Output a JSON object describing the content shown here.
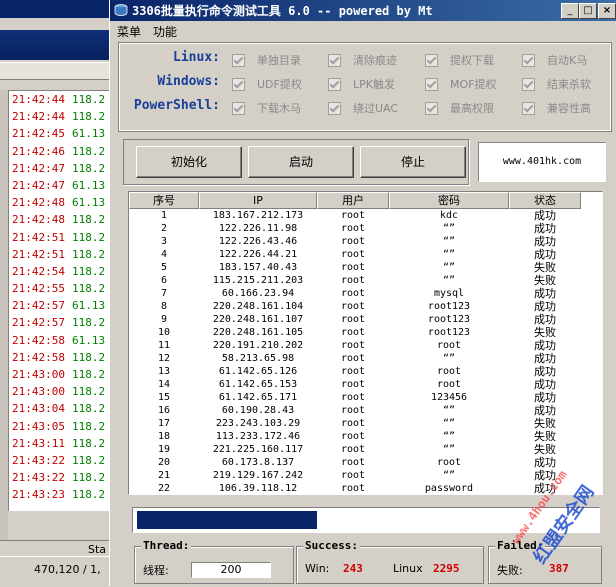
{
  "background_window": {
    "log_rows": [
      {
        "time": "21:42:44",
        "ip": "118.2"
      },
      {
        "time": "21:42:44",
        "ip": "118.2"
      },
      {
        "time": "21:42:45",
        "ip": "61.13"
      },
      {
        "time": "21:42:46",
        "ip": "118.2"
      },
      {
        "time": "21:42:47",
        "ip": "118.2"
      },
      {
        "time": "21:42:47",
        "ip": "61.13"
      },
      {
        "time": "21:42:48",
        "ip": "61.13"
      },
      {
        "time": "21:42:48",
        "ip": "118.2"
      },
      {
        "time": "21:42:51",
        "ip": "118.2"
      },
      {
        "time": "21:42:51",
        "ip": "118.2"
      },
      {
        "time": "21:42:54",
        "ip": "118.2"
      },
      {
        "time": "21:42:55",
        "ip": "118.2"
      },
      {
        "time": "21:42:57",
        "ip": "61.13"
      },
      {
        "time": "21:42:57",
        "ip": "118.2"
      },
      {
        "time": "21:42:58",
        "ip": "61.13"
      },
      {
        "time": "21:42:58",
        "ip": "118.2"
      },
      {
        "time": "21:43:00",
        "ip": "118.2"
      },
      {
        "time": "21:43:00",
        "ip": "118.2"
      },
      {
        "time": "21:43:04",
        "ip": "118.2"
      },
      {
        "time": "21:43:05",
        "ip": "118.2"
      },
      {
        "time": "21:43:11",
        "ip": "118.2"
      },
      {
        "time": "21:43:22",
        "ip": "118.2"
      },
      {
        "time": "21:43:22",
        "ip": "118.2"
      },
      {
        "time": "21:43:23",
        "ip": "118.2"
      }
    ],
    "status_value": "470,120 / 1,",
    "status_label": "Sta"
  },
  "window": {
    "title": "3306批量执行命令测试工具 6.0 -- powered by Mt",
    "controls": {
      "minimize": "_",
      "maximize": "□",
      "close": "×"
    }
  },
  "menu": {
    "items": [
      "菜单",
      "功能"
    ]
  },
  "options": {
    "rows": [
      {
        "os": "Linux:",
        "checks": [
          "单独目录",
          "清除痕迹",
          "提权下载",
          "自动K马"
        ]
      },
      {
        "os": "Windows:",
        "checks": [
          "UDF提权",
          "LPK触发",
          "MOF提权",
          "结束杀软"
        ]
      },
      {
        "os": "PowerShell:",
        "checks": [
          "下载木马",
          "绕过UAC",
          "最高权限",
          "兼容性高"
        ]
      }
    ]
  },
  "buttons": {
    "init": "初始化",
    "start": "启动",
    "stop": "停止"
  },
  "site": "www.401hk.com",
  "table": {
    "headers": [
      "序号",
      "IP",
      "用户",
      "密码",
      "状态"
    ],
    "rows": [
      [
        "1",
        "183.167.212.173",
        "root",
        "kdc",
        "成功"
      ],
      [
        "2",
        "122.226.11.98",
        "root",
        "“”",
        "成功"
      ],
      [
        "3",
        "122.226.43.46",
        "root",
        "“”",
        "成功"
      ],
      [
        "4",
        "122.226.44.21",
        "root",
        "“”",
        "成功"
      ],
      [
        "5",
        "183.157.40.43",
        "root",
        "“”",
        "失败"
      ],
      [
        "6",
        "115.215.211.203",
        "root",
        "“”",
        "失败"
      ],
      [
        "7",
        "60.166.23.94",
        "root",
        "mysql",
        "成功"
      ],
      [
        "8",
        "220.248.161.104",
        "root",
        "root123",
        "成功"
      ],
      [
        "9",
        "220.248.161.107",
        "root",
        "root123",
        "成功"
      ],
      [
        "10",
        "220.248.161.105",
        "root",
        "root123",
        "失败"
      ],
      [
        "11",
        "220.191.210.202",
        "root",
        "root",
        "成功"
      ],
      [
        "12",
        "58.213.65.98",
        "root",
        "“”",
        "成功"
      ],
      [
        "13",
        "61.142.65.126",
        "root",
        "root",
        "成功"
      ],
      [
        "14",
        "61.142.65.153",
        "root",
        "root",
        "成功"
      ],
      [
        "15",
        "61.142.65.171",
        "root",
        "123456",
        "成功"
      ],
      [
        "16",
        "60.190.28.43",
        "root",
        "“”",
        "成功"
      ],
      [
        "17",
        "223.243.103.29",
        "root",
        "“”",
        "失败"
      ],
      [
        "18",
        "113.233.172.46",
        "root",
        "“”",
        "失败"
      ],
      [
        "19",
        "221.225.160.117",
        "root",
        "“”",
        "失败"
      ],
      [
        "20",
        "60.173.8.137",
        "root",
        "root",
        "成功"
      ],
      [
        "21",
        "219.129.167.242",
        "root",
        "“”",
        "成功"
      ],
      [
        "22",
        "106.39.118.12",
        "root",
        "password",
        "成功"
      ]
    ]
  },
  "progress": {
    "filled_segments": 12,
    "total_segments": 30
  },
  "stats": {
    "thread": {
      "label": "Thread:",
      "field_label": "线程:",
      "value": "200"
    },
    "success": {
      "label": "Success:",
      "win_label": "Win:",
      "win": "243",
      "linux_label": "Linux",
      "linux": "2295"
    },
    "failed": {
      "label": "Failed:",
      "fail_label": "失败:",
      "fail": "387"
    }
  },
  "watermark": {
    "text": "红盟安全网",
    "url": "www.4hou.com"
  }
}
